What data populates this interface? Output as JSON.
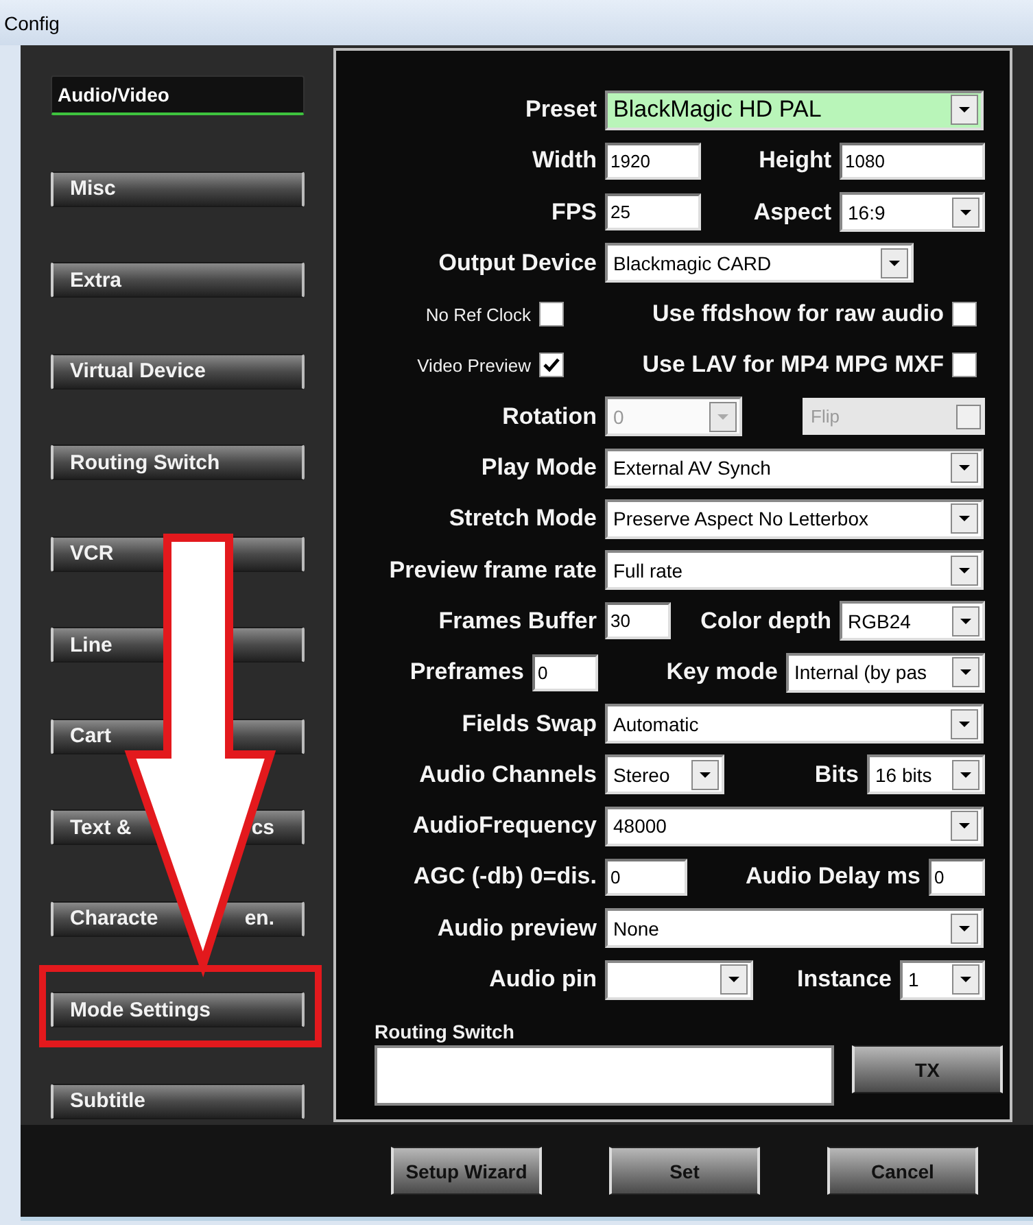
{
  "window": {
    "title": "Config"
  },
  "sidebar": {
    "items": [
      {
        "label": "Audio/Video",
        "selected": true
      },
      {
        "label": "Misc",
        "selected": false
      },
      {
        "label": "Extra",
        "selected": false
      },
      {
        "label": "Virtual Device",
        "selected": false
      },
      {
        "label": "Routing Switch",
        "selected": false
      },
      {
        "label": "VCR",
        "selected": false
      },
      {
        "label": "Line",
        "selected": false
      },
      {
        "label": "Cart",
        "selected": false
      },
      {
        "label_parts": [
          "Text &",
          "cs"
        ],
        "selected": false
      },
      {
        "label_parts": [
          "Characte",
          "en."
        ],
        "selected": false
      },
      {
        "label": "Mode Settings",
        "selected": false
      },
      {
        "label": "Subtitle",
        "selected": false
      }
    ]
  },
  "form": {
    "rows": [
      {
        "items": [
          {
            "kind": "label",
            "text": "Preset"
          },
          {
            "kind": "select",
            "value": "BlackMagic HD PAL",
            "highlighted": true
          }
        ]
      },
      {
        "items": [
          {
            "kind": "label",
            "text": "Width"
          },
          {
            "kind": "input",
            "value": "1920"
          },
          {
            "kind": "label",
            "text": "Height"
          },
          {
            "kind": "input",
            "value": "1080"
          }
        ]
      },
      {
        "items": [
          {
            "kind": "label",
            "text": "FPS"
          },
          {
            "kind": "input",
            "value": "25"
          },
          {
            "kind": "label",
            "text": "Aspect"
          },
          {
            "kind": "select",
            "value": "16:9"
          }
        ]
      },
      {
        "items": [
          {
            "kind": "label",
            "text": "Output Device"
          },
          {
            "kind": "select",
            "value": "Blackmagic CARD"
          }
        ]
      },
      {
        "items": [
          {
            "kind": "small-label",
            "text": "No Ref Clock"
          },
          {
            "kind": "checkbox",
            "checked": false
          },
          {
            "kind": "label",
            "text": "Use ffdshow for raw audio"
          },
          {
            "kind": "checkbox",
            "checked": false
          }
        ]
      },
      {
        "items": [
          {
            "kind": "small-label",
            "text": "Video Preview"
          },
          {
            "kind": "checkbox",
            "checked": true
          },
          {
            "kind": "label",
            "text": "Use LAV for MP4 MPG MXF"
          },
          {
            "kind": "checkbox",
            "checked": false
          }
        ]
      },
      {
        "items": [
          {
            "kind": "label",
            "text": "Rotation"
          },
          {
            "kind": "select",
            "value": "0",
            "disabled": true
          },
          {
            "kind": "check-field",
            "text": "Flip",
            "checked": false,
            "disabled": true
          }
        ]
      },
      {
        "items": [
          {
            "kind": "label",
            "text": "Play Mode"
          },
          {
            "kind": "select",
            "value": "External AV Synch"
          }
        ]
      },
      {
        "items": [
          {
            "kind": "label",
            "text": "Stretch Mode"
          },
          {
            "kind": "select",
            "value": "Preserve Aspect No Letterbox"
          }
        ]
      },
      {
        "items": [
          {
            "kind": "label",
            "text": "Preview frame rate"
          },
          {
            "kind": "select",
            "value": "Full rate"
          }
        ]
      },
      {
        "items": [
          {
            "kind": "label",
            "text": "Frames Buffer"
          },
          {
            "kind": "input",
            "value": "30"
          },
          {
            "kind": "label",
            "text": "Color depth"
          },
          {
            "kind": "select",
            "value": "RGB24"
          }
        ]
      },
      {
        "items": [
          {
            "kind": "label",
            "text": "Preframes"
          },
          {
            "kind": "input",
            "value": "0"
          },
          {
            "kind": "label",
            "text": "Key mode"
          },
          {
            "kind": "select",
            "value": "Internal (by pas"
          }
        ]
      },
      {
        "items": [
          {
            "kind": "label",
            "text": "Fields Swap"
          },
          {
            "kind": "select",
            "value": "Automatic"
          }
        ]
      },
      {
        "items": [
          {
            "kind": "label",
            "text": "Audio Channels"
          },
          {
            "kind": "select",
            "value": "Stereo"
          },
          {
            "kind": "label",
            "text": "Bits"
          },
          {
            "kind": "select",
            "value": "16 bits"
          }
        ]
      },
      {
        "items": [
          {
            "kind": "label",
            "text": "AudioFrequency"
          },
          {
            "kind": "select",
            "value": "48000"
          }
        ]
      },
      {
        "items": [
          {
            "kind": "label",
            "text": "AGC (-db) 0=dis."
          },
          {
            "kind": "input",
            "value": "0"
          },
          {
            "kind": "label",
            "text": "Audio Delay ms"
          },
          {
            "kind": "input",
            "value": "0"
          }
        ]
      },
      {
        "items": [
          {
            "kind": "label",
            "text": "Audio preview"
          },
          {
            "kind": "select",
            "value": "None"
          }
        ]
      },
      {
        "items": [
          {
            "kind": "label",
            "text": "Audio pin"
          },
          {
            "kind": "select"
          },
          {
            "kind": "label",
            "text": "Instance"
          },
          {
            "kind": "select",
            "value": "1"
          }
        ]
      }
    ],
    "routing_switch": {
      "label": "Routing Switch",
      "button": "TX"
    }
  },
  "buttons": [
    "Setup Wizard",
    "Set",
    "Cancel"
  ]
}
